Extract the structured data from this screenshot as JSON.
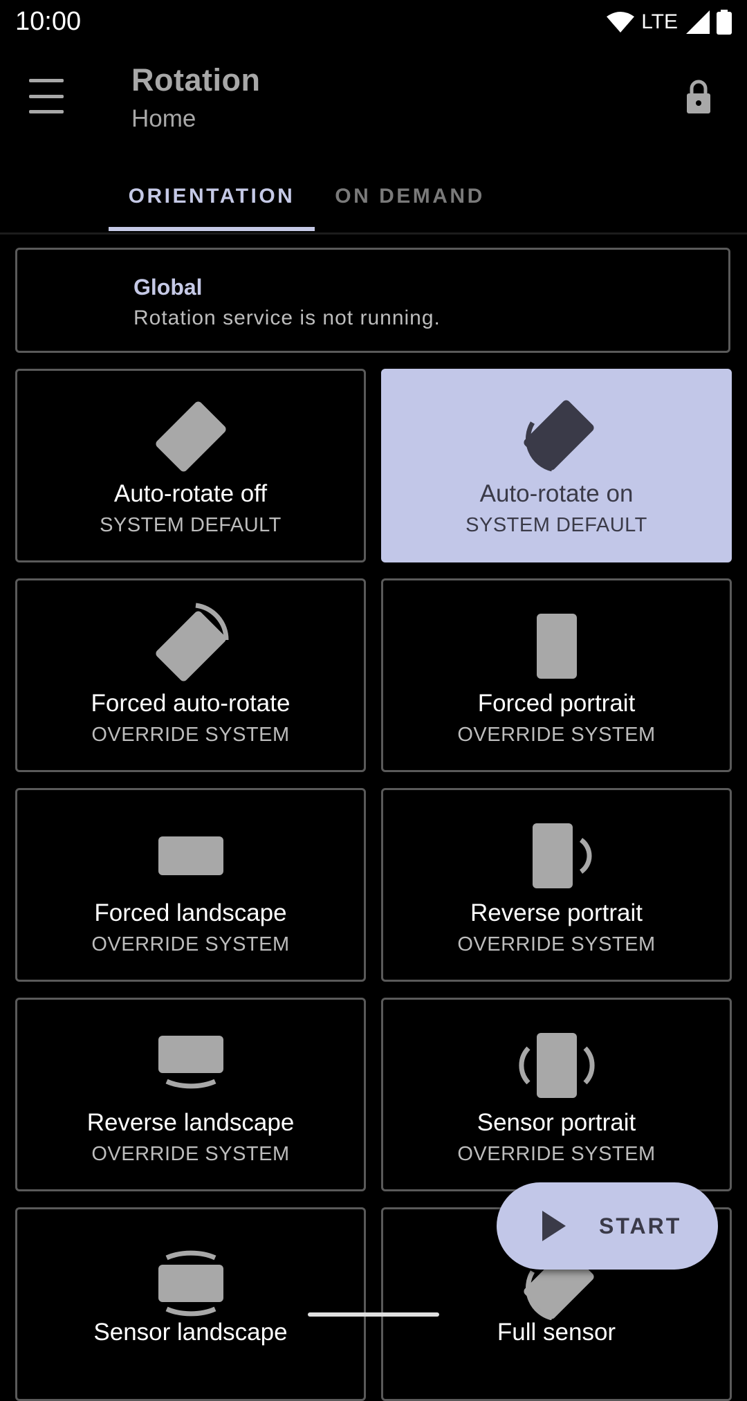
{
  "status_bar": {
    "time": "10:00",
    "network": "LTE"
  },
  "app_bar": {
    "title": "Rotation",
    "subtitle": "Home"
  },
  "tabs": [
    {
      "label": "ORIENTATION",
      "selected": true
    },
    {
      "label": "ON DEMAND",
      "selected": false
    }
  ],
  "global": {
    "title": "Global",
    "status": "Rotation service is not running."
  },
  "modes": [
    {
      "title": "Auto-rotate off",
      "subtitle": "SYSTEM DEFAULT",
      "icon": "auto-rotate-off-icon",
      "selected": false
    },
    {
      "title": "Auto-rotate on",
      "subtitle": "SYSTEM DEFAULT",
      "icon": "auto-rotate-on-icon",
      "selected": true
    },
    {
      "title": "Forced auto-rotate",
      "subtitle": "OVERRIDE SYSTEM",
      "icon": "forced-auto-rotate-icon",
      "selected": false
    },
    {
      "title": "Forced portrait",
      "subtitle": "OVERRIDE SYSTEM",
      "icon": "portrait-icon",
      "selected": false
    },
    {
      "title": "Forced landscape",
      "subtitle": "OVERRIDE SYSTEM",
      "icon": "landscape-icon",
      "selected": false
    },
    {
      "title": "Reverse portrait",
      "subtitle": "OVERRIDE SYSTEM",
      "icon": "reverse-portrait-icon",
      "selected": false
    },
    {
      "title": "Reverse landscape",
      "subtitle": "OVERRIDE SYSTEM",
      "icon": "reverse-landscape-icon",
      "selected": false
    },
    {
      "title": "Sensor portrait",
      "subtitle": "OVERRIDE SYSTEM",
      "icon": "sensor-portrait-icon",
      "selected": false
    },
    {
      "title": "Sensor landscape",
      "subtitle": "",
      "icon": "sensor-landscape-icon",
      "selected": false
    },
    {
      "title": "Full sensor",
      "subtitle": "",
      "icon": "full-sensor-icon",
      "selected": false
    }
  ],
  "fab": {
    "label": "START",
    "icon": "play-icon"
  },
  "colors": {
    "accent": "#c5c9e6",
    "selected_card": "#c2c7e8",
    "icon_gray": "#a8a8a8",
    "border": "#5a5a5a"
  }
}
